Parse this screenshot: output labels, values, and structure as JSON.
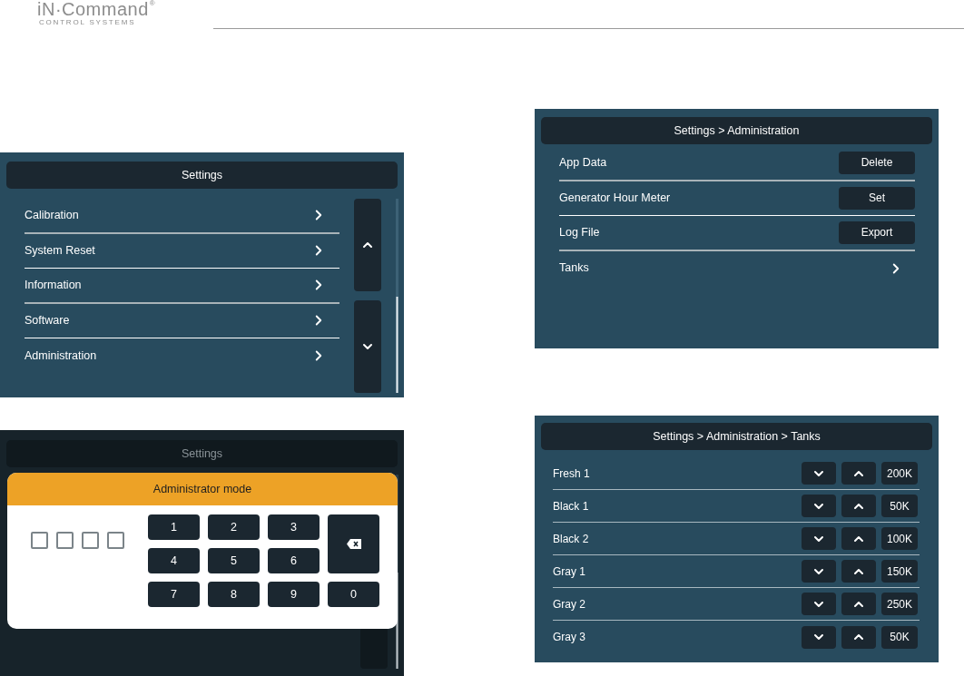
{
  "logo": {
    "name": "iN·Command",
    "mark": "®",
    "tagline": "CONTROL SYSTEMS"
  },
  "settings_screen": {
    "title": "Settings",
    "items": [
      {
        "label": "Calibration"
      },
      {
        "label": "System Reset"
      },
      {
        "label": "Information"
      },
      {
        "label": "Software"
      },
      {
        "label": "Administration"
      }
    ]
  },
  "administration_screen": {
    "title": "Settings > Administration",
    "rows": [
      {
        "kind": "button",
        "label": "App Data",
        "button": "Delete"
      },
      {
        "kind": "button",
        "label": "Generator Hour Meter",
        "button": "Set"
      },
      {
        "kind": "button",
        "label": "Log File",
        "button": "Export"
      },
      {
        "kind": "link",
        "label": "Tanks"
      }
    ]
  },
  "admin_mode_screen": {
    "background_title": "Settings",
    "dialog_title": "Administrator mode",
    "keys": [
      "1",
      "2",
      "3",
      "4",
      "5",
      "6",
      "7",
      "8",
      "9",
      "0"
    ]
  },
  "tanks_screen": {
    "title": "Settings > Administration > Tanks",
    "rows": [
      {
        "label": "Fresh 1",
        "value": "200K"
      },
      {
        "label": "Black 1",
        "value": "50K"
      },
      {
        "label": "Black 2",
        "value": "100K"
      },
      {
        "label": "Gray 1",
        "value": "150K"
      },
      {
        "label": "Gray 2",
        "value": "250K"
      },
      {
        "label": "Gray 3",
        "value": "50K"
      }
    ]
  }
}
